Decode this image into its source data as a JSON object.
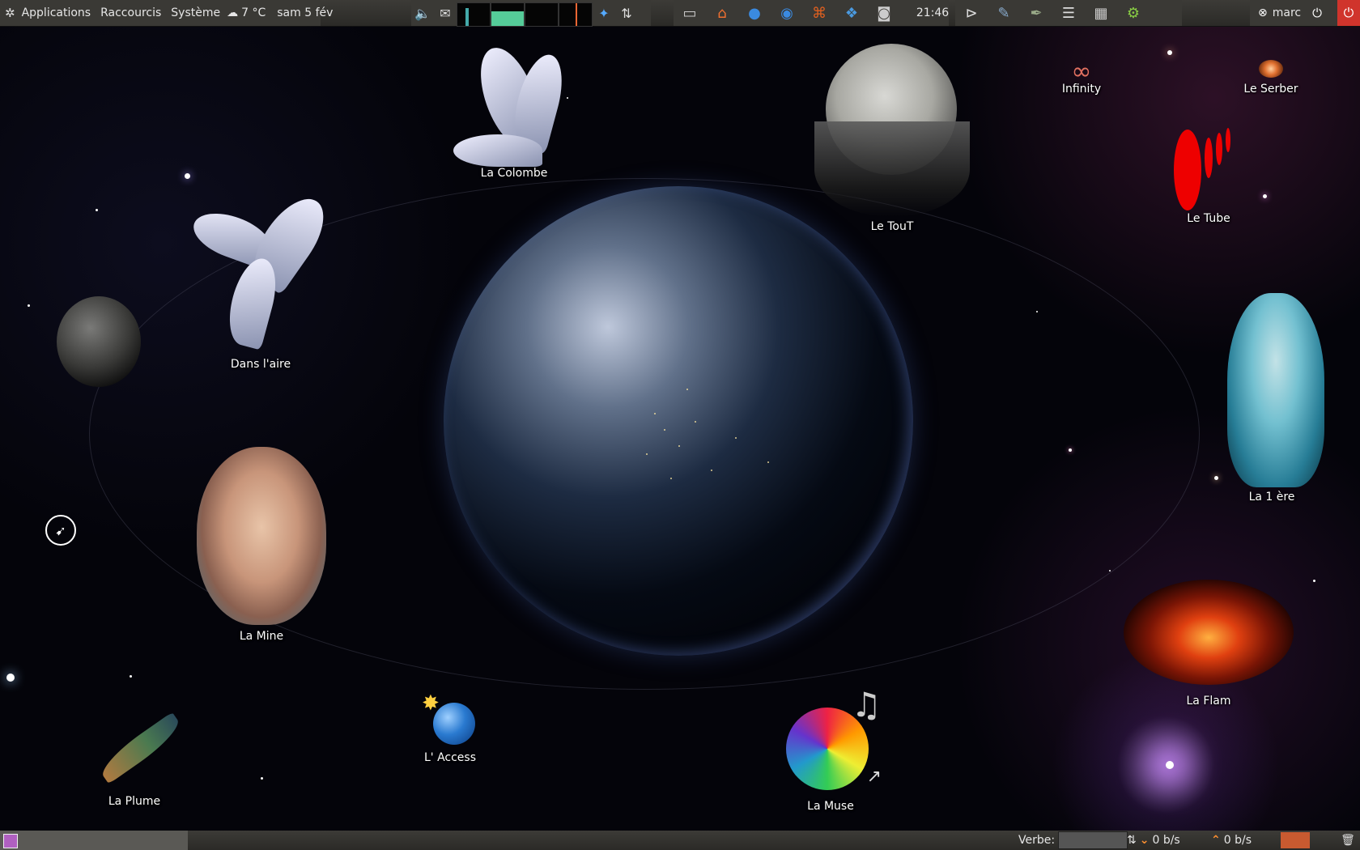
{
  "top_panel": {
    "menu": {
      "applications": "Applications",
      "places": "Raccourcis",
      "system": "Système"
    },
    "weather": {
      "temp": "7 °C",
      "date": "sam  5 fév"
    },
    "clock": "21:46",
    "user": "marc",
    "tray_icons": [
      "volume-icon",
      "mail-icon",
      "system-monitor",
      "dropbox-icon",
      "network-icon"
    ],
    "launchers": [
      "terminal-icon",
      "home-folder-icon",
      "web-browser-icon",
      "access-icon",
      "app-icon",
      "dropbox-icon",
      "screenshot-icon",
      "terminal-dark-icon",
      "editor-icon",
      "feather-icon",
      "notes-icon",
      "calculator-icon",
      "settings-icon"
    ]
  },
  "desktop": {
    "icons": {
      "la_colombe": "La Colombe",
      "le_tout": "Le TouT",
      "infinity": "Infinity",
      "le_serber": "Le Serber",
      "le_tube": "Le Tube",
      "dans_laire": "Dans l'aire",
      "la_1ere": "La 1 ère",
      "la_mine": "La Mine",
      "la_flam": "La Flam",
      "l_access": "L' Access",
      "la_muse": "La Muse",
      "la_plume": "La Plume"
    }
  },
  "bottom_panel": {
    "verbe_label": "Verbe:",
    "net_down": "0 b/s",
    "net_up": "0 b/s"
  },
  "colors": {
    "panel": "#3a3935",
    "power": "#d0342c",
    "net_arrow": "#ff9030"
  }
}
